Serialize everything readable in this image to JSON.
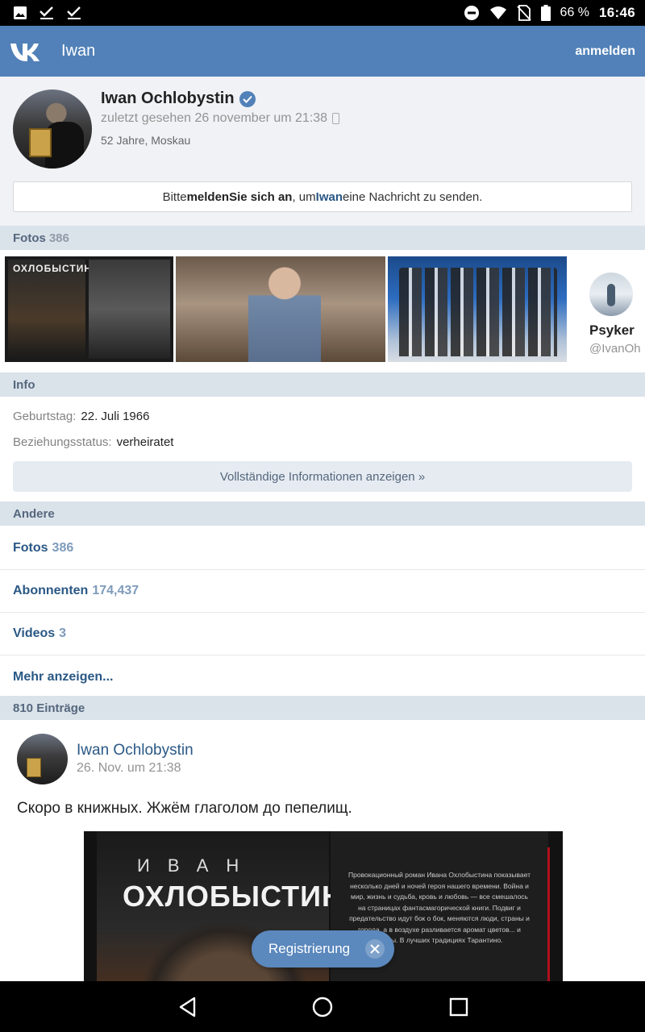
{
  "status_bar": {
    "battery": "66 %",
    "time": "16:46",
    "icons": [
      "image-icon",
      "check-icon",
      "check-icon",
      "do-not-disturb-icon",
      "wifi-icon",
      "no-sim-icon",
      "battery-icon"
    ]
  },
  "header": {
    "title": "Iwan",
    "login": "anmelden",
    "brand_color": "#5181b8"
  },
  "profile": {
    "name": "Iwan Ochlobystin",
    "last_seen": "zuletzt gesehen 26 november um 21:38",
    "location": "52 Jahre, Moskau",
    "login_prompt": {
      "before": "Bitte ",
      "bold": "meldenSie sich an",
      "middle": ", um ",
      "name": "Iwan",
      "after": " eine Nachricht zu senden."
    }
  },
  "photos": {
    "label": "Fotos",
    "count": "386",
    "thumb1_caption": "ОХЛОБЫСТИН",
    "suggested": {
      "name": "Psyker",
      "handle": "@IvanOh"
    }
  },
  "info": {
    "label": "Info",
    "rows": [
      {
        "label": "Geburtstag:",
        "value": "22. Juli 1966"
      },
      {
        "label": "Beziehungsstatus:",
        "value": "verheiratet"
      }
    ],
    "full_button": "Vollständige Informationen anzeigen »"
  },
  "other": {
    "label": "Andere",
    "items": [
      {
        "label": "Fotos",
        "count": "386"
      },
      {
        "label": "Abonnenten",
        "count": "174,437"
      },
      {
        "label": "Videos",
        "count": "3"
      },
      {
        "label": "Mehr anzeigen...",
        "count": ""
      }
    ]
  },
  "posts": {
    "label": "810 Einträge",
    "post": {
      "author": "Iwan Ochlobystin",
      "date": "26. Nov. um 21:38",
      "text": "Скоро в книжных. Жжём глаголом до пепелищ.",
      "image_title_small": "ИВАН",
      "image_title_big": "ОХЛОБЫСТИН",
      "image_blurb": "Провокационный роман Ивана Охлобыстина показывает несколько дней и ночей героя нашего времени. Война и мир, жизнь и судьба, кровь и любовь — все смешалось на страницах фантасмагорической книги. Подвиг и предательство идут бок о бок, меняются люди, страны и города, а в воздухе разливается аромат цветов... и войны. В лучших традициях Тарантино."
    }
  },
  "register_button": "Registrierung"
}
